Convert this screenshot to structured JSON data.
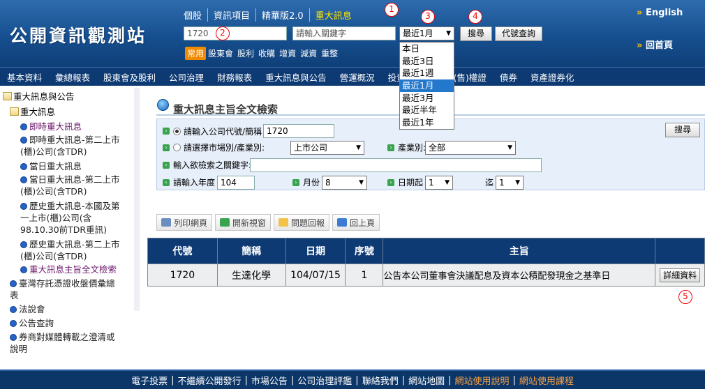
{
  "header": {
    "logo": "公開資訊觀測站",
    "toplinks": [
      "個股",
      "資訊項目",
      "精華版2.0",
      "重大訊息"
    ],
    "english": "English",
    "home": "回首頁",
    "stock_input": "1720",
    "keyword_placeholder": "請輸入關鍵字",
    "period_selected": "最近1月",
    "search_button": "搜尋",
    "code_lookup_button": "代號查詢",
    "common_tag": "常用",
    "quick_links": [
      "股東會",
      "股利",
      "收購",
      "增資",
      "減資",
      "重整"
    ],
    "period_options": [
      "本日",
      "最近3日",
      "最近1週",
      "最近1月",
      "最近3月",
      "最近半年",
      "最近1年"
    ]
  },
  "markers": [
    "1",
    "2",
    "3",
    "4",
    "5"
  ],
  "nav": [
    "基本資料",
    "彙總報表",
    "股東會及股利",
    "公司治理",
    "財務報表",
    "重大訊息與公告",
    "營運概況",
    "投資專區",
    "認購(售)權證",
    "債券",
    "資產證券化"
  ],
  "sidebar": {
    "root": "重大訊息與公告",
    "group": "重大訊息",
    "items": [
      "即時重大訊息",
      "即時重大訊息-第二上市(櫃)公司(含TDR)",
      "當日重大訊息",
      "當日重大訊息-第二上市(櫃)公司(含TDR)",
      "歷史重大訊息-本國及第一上市(櫃)公司(含98.10.30前TDR重訊)",
      "歷史重大訊息-第二上市(櫃)公司(含TDR)",
      "重大訊息主旨全文檢索"
    ],
    "top_items": [
      "臺灣存託憑證收盤價彙總表",
      "法說會",
      "公告查詢",
      "券商對媒體轉載之澄清或說明"
    ]
  },
  "page": {
    "title": "重大訊息主旨全文檢索",
    "company_label": "請輸入公司代號/簡稱",
    "company_value": "1720",
    "market_label": "請選擇市場別/產業別:",
    "market_value": "上市公司",
    "industry_label": "產業別:",
    "industry_value": "全部",
    "keyword_label": "輸入欲檢索之關鍵字:",
    "keyword_value": "",
    "year_label": "請輸入年度",
    "year_value": "104",
    "month_label": "月份",
    "month_value": "8",
    "day_from_label": "日期起",
    "day_from_value": "1",
    "day_to_label": "迄",
    "day_to_value": "1",
    "search_button": "搜尋"
  },
  "toolbar": [
    "列印網頁",
    "開新視窗",
    "問題回報",
    "回上頁"
  ],
  "table": {
    "headers": [
      "代號",
      "簡稱",
      "日期",
      "序號",
      "主旨",
      ""
    ],
    "rows": [
      [
        "1720",
        "生達化學",
        "104/07/15",
        "1",
        "公告本公司董事會決議配息及資本公積配發現金之基準日",
        "詳細資料"
      ]
    ]
  },
  "footer": [
    "電子投票",
    "不繼續公開發行",
    "市場公告",
    "公司治理評鑑",
    "聯絡我們",
    "網站地圖",
    "網站使用說明",
    "網站使用課程"
  ]
}
